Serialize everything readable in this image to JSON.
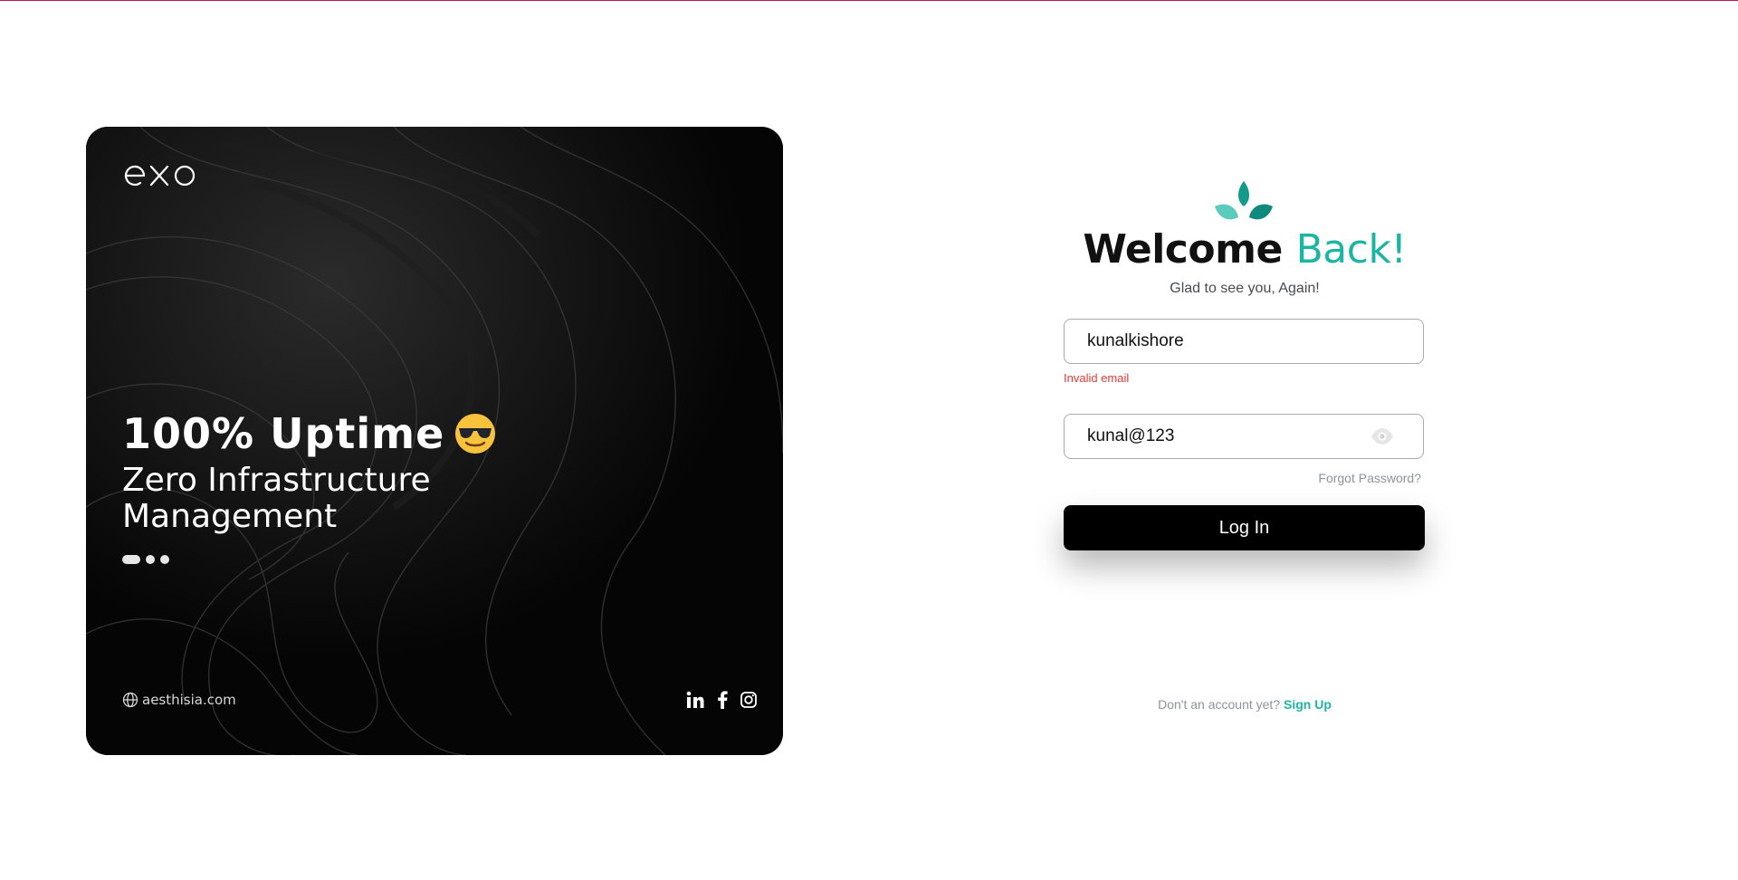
{
  "hero": {
    "brand": "exo",
    "headline": "100% Uptime",
    "emoji": "smiling-face-with-sunglasses",
    "subline": "Zero Infrastructure Management",
    "carousel": {
      "count": 3,
      "active": 1
    },
    "site": "aesthisia.com",
    "socials": [
      "linkedin-icon",
      "facebook-icon",
      "instagram-icon"
    ]
  },
  "login": {
    "title_main": "Welcome ",
    "title_accent": "Back!",
    "subtitle": "Glad to see you, Again!",
    "email_value": "kunalkishore",
    "email_error": "Invalid email",
    "password_value": "kunal@123",
    "forgot_label": "Forgot Password?",
    "submit_label": "Log In",
    "signup_prompt": "Don't an account yet?",
    "signup_link": "Sign Up"
  },
  "colors": {
    "accent": "#1cb5a3",
    "error": "#e53935",
    "button": "#000000",
    "hero_bg": "#050505"
  }
}
